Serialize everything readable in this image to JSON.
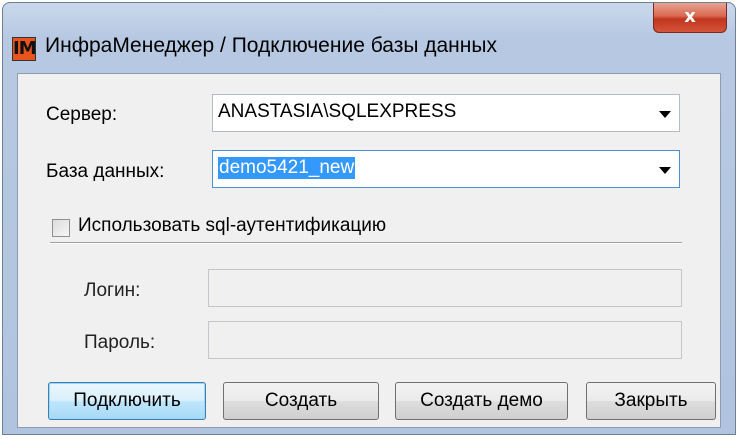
{
  "window": {
    "app_icon_text": "IM",
    "title": "ИнфраМенеджер / Подключение базы данных",
    "close_symbol": "x"
  },
  "form": {
    "server_label": "Сервер:",
    "server_value": "ANASTASIA\\SQLEXPRESS",
    "database_label": "База данных:",
    "database_value": "demo5421_new",
    "sql_auth_label": "Использовать sql-аутентификацию",
    "sql_auth_checked": false,
    "login_label": "Логин:",
    "login_value": "",
    "password_label": "Пароль:",
    "password_value": ""
  },
  "buttons": {
    "connect": "Подключить",
    "create": "Создать",
    "create_demo": "Создать демо",
    "close": "Закрыть"
  },
  "icons": {
    "app": "app-logo-icon",
    "close": "close-icon",
    "dropdown": "chevron-down-icon"
  }
}
